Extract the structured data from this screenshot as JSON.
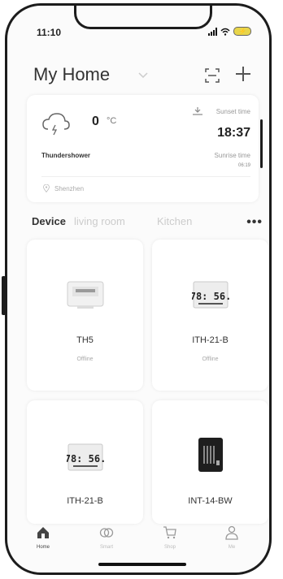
{
  "status_bar": {
    "time": "11:10"
  },
  "header": {
    "title": "My Home"
  },
  "weather": {
    "temperature": "0",
    "unit": "°C",
    "condition": "Thundershower",
    "sunset_label": "Sunset time",
    "sunset_time": "18:37",
    "sunrise_label": "Sunrise time",
    "sunrise_time": "06:19",
    "location": "Shenzhen"
  },
  "tabs": [
    {
      "label": "Device",
      "active": true
    },
    {
      "label": "living room",
      "active": false
    },
    {
      "label": "Kitchen",
      "active": false
    }
  ],
  "tabs_more": "•••",
  "devices": [
    {
      "name": "TH5",
      "status": "Offline",
      "image": "thermometer-white-display-icon"
    },
    {
      "name": "ITH-21-B",
      "status": "Offline",
      "image": "lcd-thermo-hygrometer-icon",
      "display": "78: 56."
    },
    {
      "name": "ITH-21-B",
      "status": "",
      "image": "lcd-thermo-hygrometer-icon",
      "display": "78: 56."
    },
    {
      "name": "INT-14-BW",
      "status": "",
      "image": "black-panel-device-icon"
    }
  ],
  "nav": [
    {
      "label": "Home",
      "icon": "home-icon",
      "active": true
    },
    {
      "label": "Smart",
      "icon": "smart-icon",
      "active": false
    },
    {
      "label": "Shop",
      "icon": "cart-icon",
      "active": false
    },
    {
      "label": "Me",
      "icon": "person-icon",
      "active": false
    }
  ],
  "colors": {
    "battery": "#e8d54a",
    "frame": "#1c1c1c"
  }
}
